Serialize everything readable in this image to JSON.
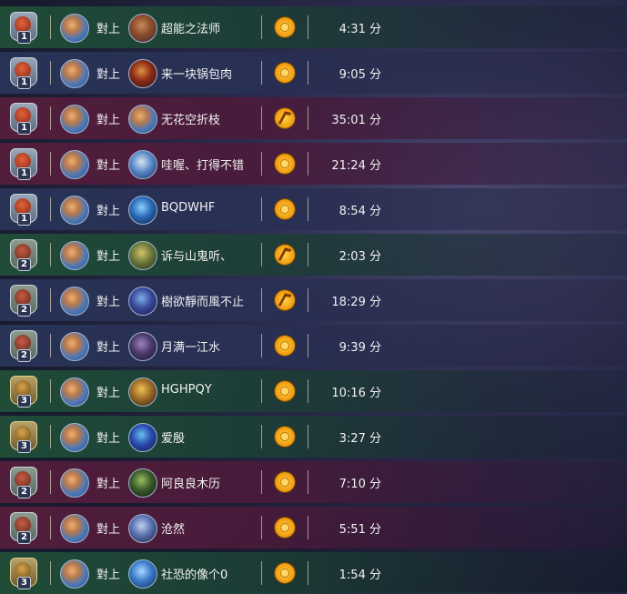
{
  "vs_label": "對上",
  "duration_unit": "分",
  "matches": [
    {
      "result": "win",
      "rank": "1",
      "opponent": "超能之法师",
      "mode": "standard",
      "duration": "4:31"
    },
    {
      "result": "neutral",
      "rank": "1",
      "opponent": "来一块锅包肉",
      "mode": "standard",
      "duration": "9:05"
    },
    {
      "result": "loss",
      "rank": "1",
      "opponent": "无花空折枝",
      "mode": "wild",
      "duration": "35:01"
    },
    {
      "result": "loss",
      "rank": "1",
      "opponent": "哇喔、打得不错",
      "mode": "standard",
      "duration": "21:24"
    },
    {
      "result": "neutral",
      "rank": "1",
      "opponent": "BQDWHF",
      "mode": "standard",
      "duration": "8:54"
    },
    {
      "result": "win",
      "rank": "2",
      "opponent": "诉与山鬼听、",
      "mode": "wild",
      "duration": "2:03"
    },
    {
      "result": "neutral",
      "rank": "2",
      "opponent": "樹欲靜而風不止",
      "mode": "wild",
      "duration": "18:29"
    },
    {
      "result": "neutral",
      "rank": "2",
      "opponent": "月满一江水",
      "mode": "standard",
      "duration": "9:39"
    },
    {
      "result": "win",
      "rank": "3",
      "opponent": "HGHPQY",
      "mode": "standard",
      "duration": "10:16"
    },
    {
      "result": "win",
      "rank": "3",
      "opponent": "爱殷",
      "mode": "standard",
      "duration": "3:27"
    },
    {
      "result": "loss",
      "rank": "2",
      "opponent": "阿良良木历",
      "mode": "standard",
      "duration": "7:10"
    },
    {
      "result": "loss",
      "rank": "2",
      "opponent": "沧然",
      "mode": "standard",
      "duration": "5:51"
    },
    {
      "result": "win",
      "rank": "3",
      "opponent": "社恐的像个0",
      "mode": "standard",
      "duration": "1:54"
    }
  ]
}
